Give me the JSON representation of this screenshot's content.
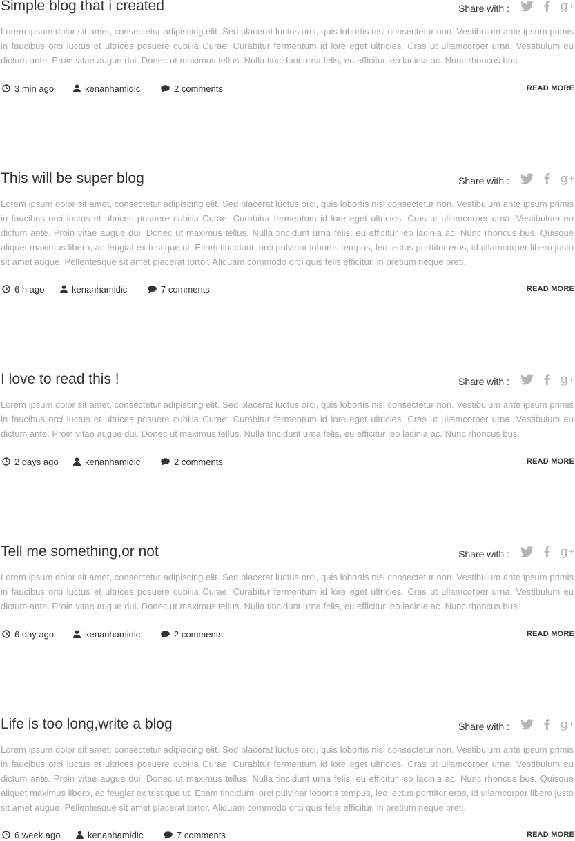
{
  "share_label": "Share with :",
  "read_more_label": "READ MORE",
  "icons": {
    "time": "clock-icon",
    "author": "user-icon",
    "comments": "comment-bubble-icon",
    "twitter": "twitter-icon",
    "facebook": "facebook-icon",
    "google_plus": "google-plus-icon"
  },
  "colors": {
    "title": "#333333",
    "body_text": "#a6a6a6",
    "share_icons": "#b5b5b5"
  },
  "posts": [
    {
      "title": "Simple blog that i created",
      "body": "Lorem ipsum dolor sit amet, consectetur adipiscing elit. Sed placerat luctus orci, quis lobortis nisl consectetur non. Vestibulum ante ipsum primis in faucibus orci luctus et ultrices posuere cubilia Curae; Curabitur fermentum id lore eget ultricies. Cras ut ullamcorper urna. Vestibu­lum eu dictum ante. Proin vitae augue dui. Donec ut maximus tellus. Nulla tincidunt urna felis, eu efficitur leo lacinia ac. Nunc rhoncus bus.",
      "time": "3 min ago",
      "author": "kenanhamidic",
      "comments": "2 comments"
    },
    {
      "title": "This will be super blog",
      "body": "Lorem ipsum dolor sit amet, consectetur adipiscing elit. Sed placerat luctus orci, quis lobortis nisl consectetur non. Vestibulum ante ipsum primis in faucibus orci luctus et ultrices posuere cubilia Curae; Curabitur fermentum id lore eget ultricies. Cras ut ullamcorper urna. Vestibu­lum eu dictum ante. Proin vitae augue dui. Donec ut maximus tellus. Nulla tincidunt urna felis, eu efficitur leo lacinia ac. Nunc rhoncus bus. Quisque aliquet maximus libero, ac feugiat ex tristique ut. Etiam tincidunt, orci pulvinar lobortis tempus, leo lectus porttitor eros, id ullam­corper libero justo sit amet augue. Pellentesque sit amet placerat tortor. Aliquam commodo orci quis felis efficitur, in pretium neque preti.",
      "time": "6 h ago",
      "author": "kenanhamidic",
      "comments": "7 comments"
    },
    {
      "title": "I love to read this !",
      "body": "Lorem ipsum dolor sit amet, consectetur adipiscing elit. Sed placerat luctus orci, quis lobortis nisl consectetur non. Vestibulum ante ipsum primis in faucibus orci luctus et ultrices posuere cubilia Curae; Curabitur fermentum id lore eget ultricies. Cras ut ullamcorper urna. Vestibu­lum eu dictum ante. Proin vitae augue dui. Donec ut maximus tellus. Nulla tincidunt urna felis, eu efficitur leo lacinia ac. Nunc rhoncus bus.",
      "time": "2 days ago",
      "author": "kenanhamidic",
      "comments": "2 comments"
    },
    {
      "title": "Tell me something,or not",
      "body": "Lorem ipsum dolor sit amet, consectetur adipiscing elit. Sed placerat luctus orci, quis lobortis nisl consectetur non. Vestibulum ante ipsum primis in faucibus orci luctus et ultrices posuere cubilia Curae; Curabitur fermentum id lore eget ultricies. Cras ut ullamcorper urna. Vestibu­lum eu dictum ante. Proin vitae augue dui. Donec ut maximus tellus. Nulla tincidunt urna felis, eu efficitur leo lacinia ac. Nunc rhoncus bus.",
      "time": "6 day ago",
      "author": "kenanhamidic",
      "comments": "2 comments"
    },
    {
      "title": "Life is too long,write a blog",
      "body": "Lorem ipsum dolor sit amet, consectetur adipiscing elit. Sed placerat luctus orci, quis lobortis nisl consectetur non. Vestibulum ante ipsum primis in faucibus orci luctus et ultrices posuere cubilia Curae; Curabitur fermentum id lore eget ultricies. Cras ut ullamcorper urna. Vestibu­lum eu dictum ante. Proin vitae augue dui. Donec ut maximus tellus. Nulla tincidunt urna felis, eu efficitur leo lacinia ac. Nunc rhoncus bus. Quisque aliquet maximus libero, ac feugiat ex tristique ut. Etiam tincidunt, orci pulvinar lobortis tempus, leo lectus porttitor eros, id ullam­corper libero justo sit amet augue. Pellentesque sit amet placerat tortor. Aliquam commodo orci quis felis efficitur, in pretium neque preti.",
      "time": "6 week ago",
      "author": "kenanhamidic",
      "comments": "7 comments"
    }
  ]
}
